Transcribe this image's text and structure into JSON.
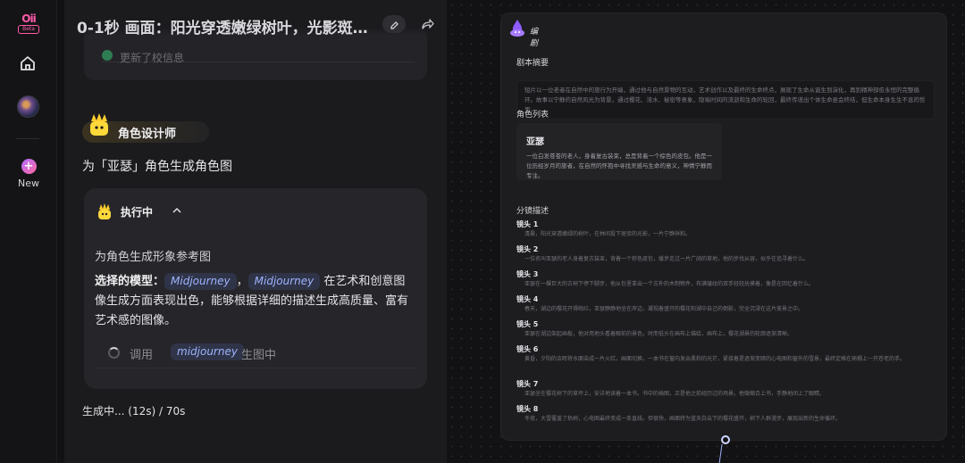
{
  "rail": {
    "logo_text": "Oii",
    "logo_badge": "Beta",
    "new_label": "New"
  },
  "chat": {
    "title": "0-1秒 画面：阳光穿透嫩绿树叶，光影斑…",
    "previous_card_text": "更新了校信息",
    "agent_chip": "角色设计师",
    "task": "为「亚瑟」角色生成角色图",
    "exec": {
      "status_label": "执行中",
      "subtitle": "为角色生成形象参考图",
      "model_prefix": "选择的模型：",
      "model_1": "Midjourney",
      "separator": "，",
      "model_2": "Midjourney",
      "model_desc": " 在艺术和创意图像生成方面表现出色，能够根据详细的描述生成高质量、富有艺术感的图像。",
      "call_prefix": "调用",
      "call_tag": "midjourney",
      "call_suffix": "生图中"
    },
    "progress": "生成中... (12s) / 70s"
  },
  "canvas": {
    "node_title": "编剧",
    "summary_label": "剧本摘要",
    "summary_text": "短片以一位老者在自然中的旅行为开端，通过他与自然景物的互动，艺术创作以及最终的生命终点，展现了生命从诞生到演化，再到精神部愈永恒的完整循环。故事以宁静的自然风光为背景，通过樱花、流水、秘密等意象，隐喻时间的流逝和生命的轮回，最终传递出个体生命虽会终结，但生命本身生生不息的哲思。",
    "roles_label": "角色列表",
    "role_name": "亚瑟",
    "role_desc": "一位白发苍苍的老人，身着复古装束，总是背着一个棕色的皮包。他是一位历经岁月的旅者，在自然的怀抱中寻找灵感与生命的意义，神情宁静而专注。",
    "shots_label": "分镜描述",
    "shots": [
      {
        "title": "镜头 1",
        "desc": "清晨，阳光穿透嫩绿的树叶，在林间投下斑驳的光影，一片宁静祥和。"
      },
      {
        "title": "镜头 2",
        "desc": "一位名叫亚瑟的老人身着复古装束，背着一个棕色皮包，缓步走过一片广阔的草地，他的步伐从容，似乎在追寻着什么。"
      },
      {
        "title": "镜头 3",
        "desc": "亚瑟在一棵巨大的古树下停下脚步，他从包里拿出一个古朴的木制物件，布满皱纹的双手轻轻抚摸着，像是在回忆着什么。"
      },
      {
        "title": "镜头 4",
        "desc": "春天，湖边的樱花开得绚烂，亚瑟静静地坐在岸边，凝视着盛开的樱花和湖中自己的倒影，完全沉浸在这片美景之中。"
      },
      {
        "title": "镜头 5",
        "desc": "亚瑟在湖边架起画板，他对用地头看着眼前的景色，时而低头在画布上描绘，画布上，樱花湖景的轮廓逐渐清晰。"
      },
      {
        "title": "镜头 6",
        "desc": "黄昏，夕阳的余晖将水面染成一片火红，画面切换，一本书在窗内发出柔和的光芒，紧接着是逐渐变暗的心电图和窗外的雪景，最终定格在病榻上一只苍老的手。"
      },
      {
        "title": "镜头 7",
        "desc": "亚瑟坐在樱花树下的草坪上，安详地读着一本书。书中的插图，正是他之前经历过的场景。他微缩合上书，手静地闭上了眼睛。"
      },
      {
        "title": "镜头 8",
        "desc": "冬夜，大雪覆盖了枯树，心电图最终变成一条直线。但很快，画面转为蓝天白云下的樱花盛开，树下人群漫步，展现出新的生命循环。"
      }
    ]
  }
}
